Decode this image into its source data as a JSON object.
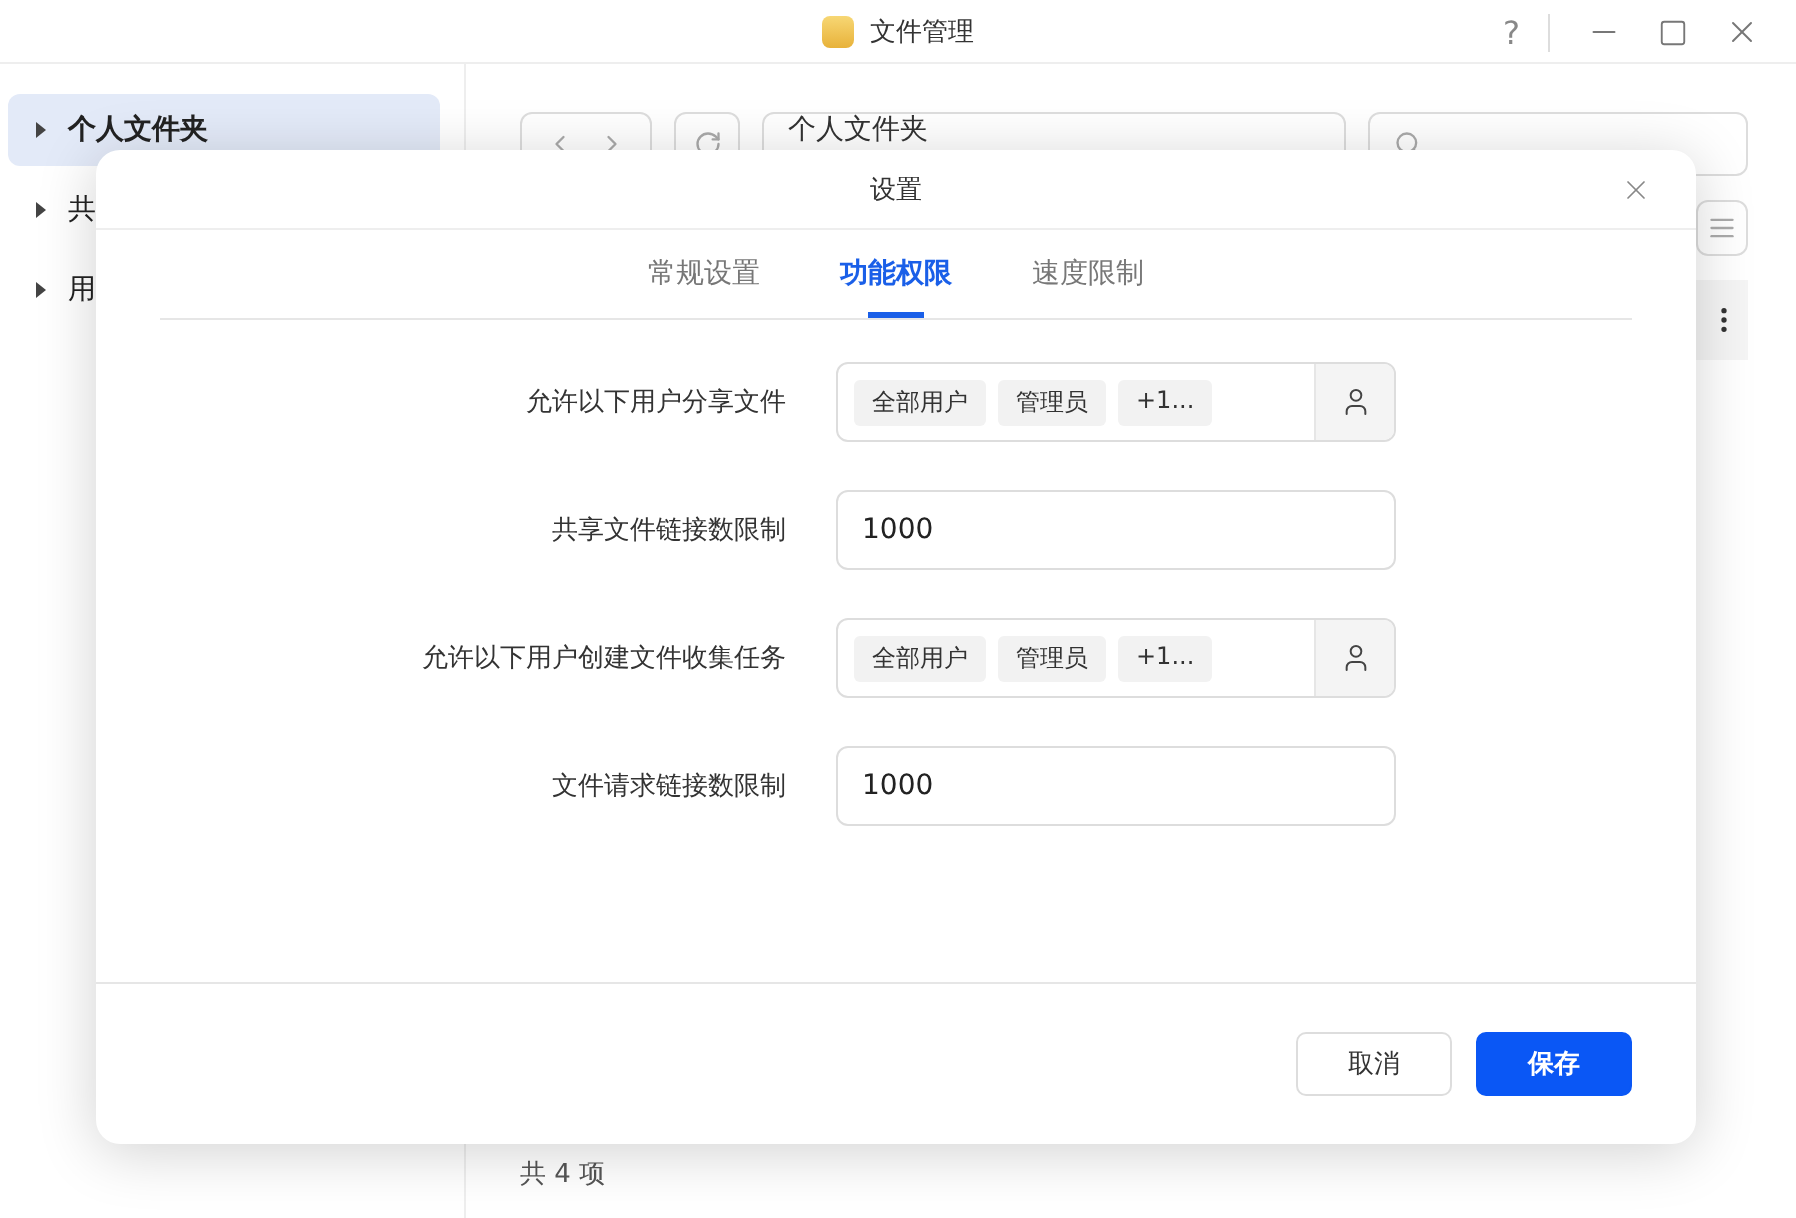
{
  "window": {
    "title": "文件管理",
    "help": "?"
  },
  "sidebar": {
    "items": [
      {
        "label": "个人文件夹",
        "selected": true
      },
      {
        "label": "共",
        "selected": false
      },
      {
        "label": "用",
        "selected": false
      }
    ]
  },
  "toolbar": {
    "path": "个人文件夹"
  },
  "status_bar": "共 4 项",
  "dialog": {
    "title": "设置",
    "tabs": [
      {
        "label": "常规设置",
        "selected": false
      },
      {
        "label": "功能权限",
        "selected": true
      },
      {
        "label": "速度限制",
        "selected": false
      }
    ],
    "rows": [
      {
        "kind": "users",
        "label": "允许以下用户分享文件",
        "tags": [
          "全部用户",
          "管理员",
          "+1..."
        ]
      },
      {
        "kind": "number",
        "label": "共享文件链接数限制",
        "value": "1000"
      },
      {
        "kind": "users",
        "label": "允许以下用户创建文件收集任务",
        "tags": [
          "全部用户",
          "管理员",
          "+1..."
        ]
      },
      {
        "kind": "number",
        "label": "文件请求链接数限制",
        "value": "1000"
      }
    ],
    "buttons": [
      {
        "kind": "secondary",
        "label": "取消"
      },
      {
        "kind": "primary",
        "label": "保存"
      }
    ]
  }
}
